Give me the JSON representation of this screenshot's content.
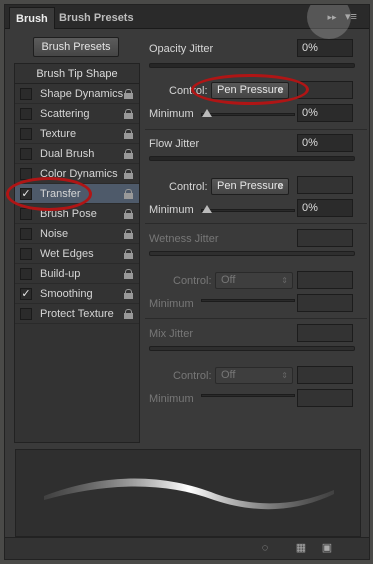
{
  "tabs": [
    {
      "label": "Brush",
      "active": true
    },
    {
      "label": "Brush Presets",
      "active": false
    }
  ],
  "left": {
    "presets_button": "Brush Presets",
    "tip_header": "Brush Tip Shape",
    "options": [
      {
        "label": "Shape Dynamics",
        "checked": false
      },
      {
        "label": "Scattering",
        "checked": false
      },
      {
        "label": "Texture",
        "checked": false
      },
      {
        "label": "Dual Brush",
        "checked": false
      },
      {
        "label": "Color Dynamics",
        "checked": false
      },
      {
        "label": "Transfer",
        "checked": true,
        "selected": true
      },
      {
        "label": "Brush Pose",
        "checked": false
      },
      {
        "label": "Noise",
        "checked": false
      },
      {
        "label": "Wet Edges",
        "checked": false
      },
      {
        "label": "Build-up",
        "checked": false
      },
      {
        "label": "Smoothing",
        "checked": true
      },
      {
        "label": "Protect Texture",
        "checked": false
      }
    ]
  },
  "right": {
    "opacity_jitter": {
      "title": "Opacity Jitter",
      "value": "0%",
      "control_label": "Control:",
      "control_value": "Pen Pressure",
      "min_label": "Minimum",
      "min_value": "0%"
    },
    "flow_jitter": {
      "title": "Flow Jitter",
      "value": "0%",
      "control_label": "Control:",
      "control_value": "Pen Pressure",
      "min_label": "Minimum",
      "min_value": "0%"
    },
    "wetness_jitter": {
      "title": "Wetness Jitter",
      "control_label": "Control:",
      "control_value": "Off",
      "min_label": "Minimum"
    },
    "mix_jitter": {
      "title": "Mix Jitter",
      "control_label": "Control:",
      "control_value": "Off",
      "min_label": "Minimum"
    }
  },
  "glyphs": {
    "check": "✓",
    "select_arrow": "⇕",
    "collapse": "▸▸",
    "menu": "▾≡"
  },
  "colors": {
    "panel": "#3a3a3a",
    "selected_row": "#4e5a6a",
    "annotation_red": "#b01515"
  }
}
